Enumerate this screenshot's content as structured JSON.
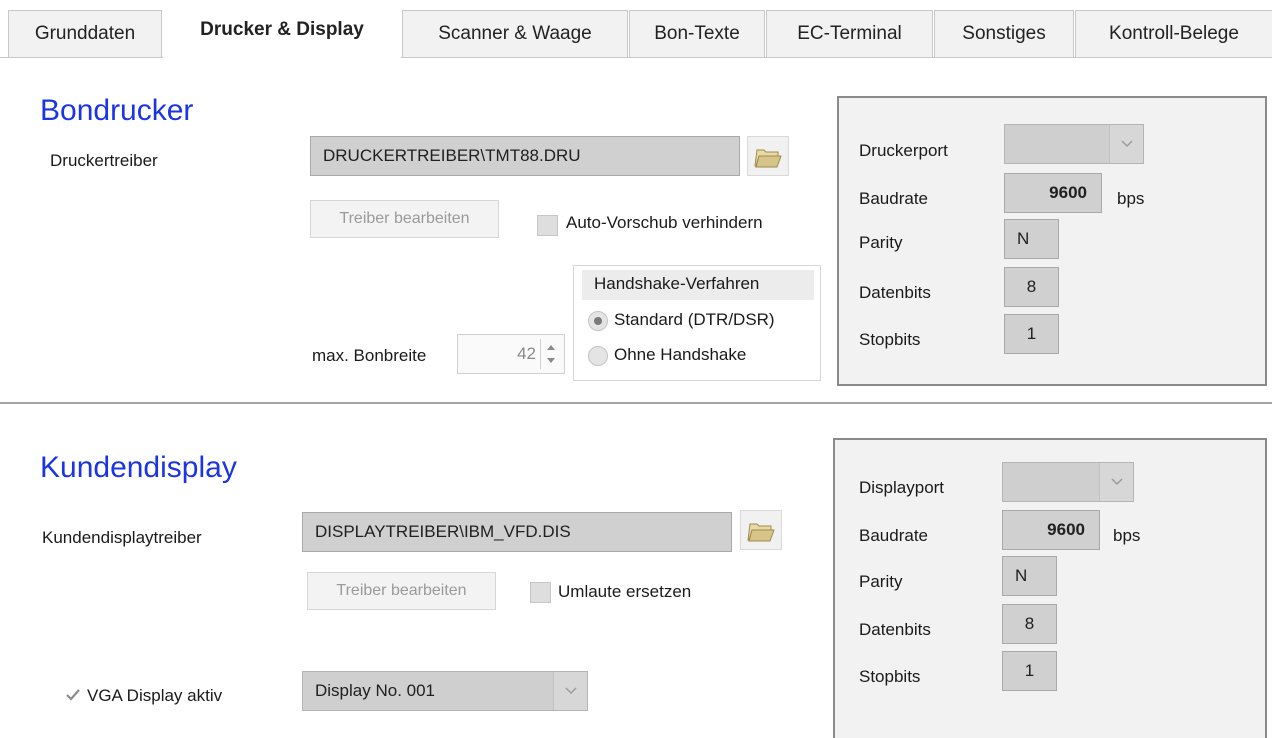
{
  "tabs": [
    {
      "label": "Grunddaten"
    },
    {
      "label": "Drucker & Display"
    },
    {
      "label": "Scanner & Waage"
    },
    {
      "label": "Bon-Texte"
    },
    {
      "label": "EC-Terminal"
    },
    {
      "label": "Sonstiges"
    },
    {
      "label": "Kontroll-Belege"
    }
  ],
  "bondrucker": {
    "title": "Bondrucker",
    "driver_label": "Druckertreiber",
    "driver_value": "DRUCKERTREIBER\\TMT88.DRU",
    "edit_button": "Treiber bearbeiten",
    "auto_feed_label": "Auto-Vorschub verhindern",
    "handshake_title": "Handshake-Verfahren",
    "handshake_options": [
      "Standard (DTR/DSR)",
      "Ohne Handshake"
    ],
    "max_width_label": "max. Bonbreite",
    "max_width_value": "42",
    "port": {
      "port_label": "Druckerport",
      "port_value": "",
      "baud_label": "Baudrate",
      "baud_value": "9600",
      "baud_unit": "bps",
      "parity_label": "Parity",
      "parity_value": "N",
      "databits_label": "Datenbits",
      "databits_value": "8",
      "stopbits_label": "Stopbits",
      "stopbits_value": "1"
    }
  },
  "kundendisplay": {
    "title": "Kundendisplay",
    "driver_label": "Kundendisplaytreiber",
    "driver_value": "DISPLAYTREIBER\\IBM_VFD.DIS",
    "edit_button": "Treiber bearbeiten",
    "umlaut_label": "Umlaute ersetzen",
    "vga_label": "VGA Display aktiv",
    "vga_select_value": "Display No. 001",
    "port": {
      "port_label": "Displayport",
      "port_value": "",
      "baud_label": "Baudrate",
      "baud_value": "9600",
      "baud_unit": "bps",
      "parity_label": "Parity",
      "parity_value": "N",
      "databits_label": "Datenbits",
      "databits_value": "8",
      "stopbits_label": "Stopbits",
      "stopbits_value": "1"
    }
  },
  "colors": {
    "section_title": "#1b35e6",
    "field_bg": "#d0d0d0",
    "panel_bg": "#f2f2f2"
  }
}
